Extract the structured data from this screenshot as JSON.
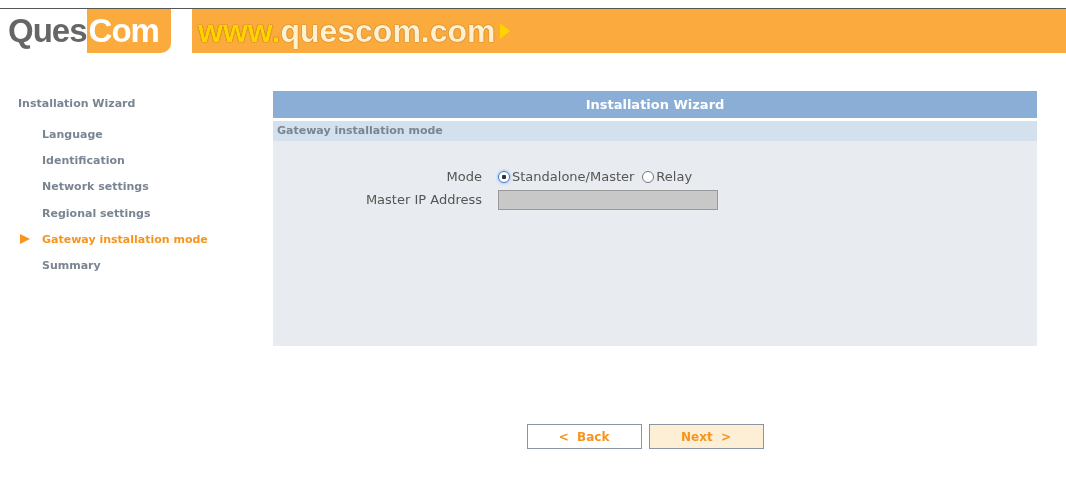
{
  "header": {
    "logo": {
      "left": "Ques",
      "right": "Com"
    },
    "url_prefix": "www.",
    "url": "quescom.com"
  },
  "sidebar": {
    "title": "Installation Wizard",
    "items": [
      {
        "label": "Language",
        "selected": false
      },
      {
        "label": "Identification",
        "selected": false
      },
      {
        "label": "Network settings",
        "selected": false
      },
      {
        "label": "Regional settings",
        "selected": false
      },
      {
        "label": "Gateway installation mode",
        "selected": true
      },
      {
        "label": "Summary",
        "selected": false
      }
    ]
  },
  "panel": {
    "title": "Installation Wizard",
    "section": "Gateway installation mode",
    "mode": {
      "label": "Mode",
      "options": [
        {
          "label": "Standalone/Master",
          "selected": true
        },
        {
          "label": "Relay",
          "selected": false
        }
      ]
    },
    "master_ip": {
      "label": "Master IP Address",
      "disabled": true
    }
  },
  "buttons": [
    {
      "label": "<  Back",
      "kind": "secondary"
    },
    {
      "label": "Next  >",
      "kind": "primary"
    }
  ]
}
